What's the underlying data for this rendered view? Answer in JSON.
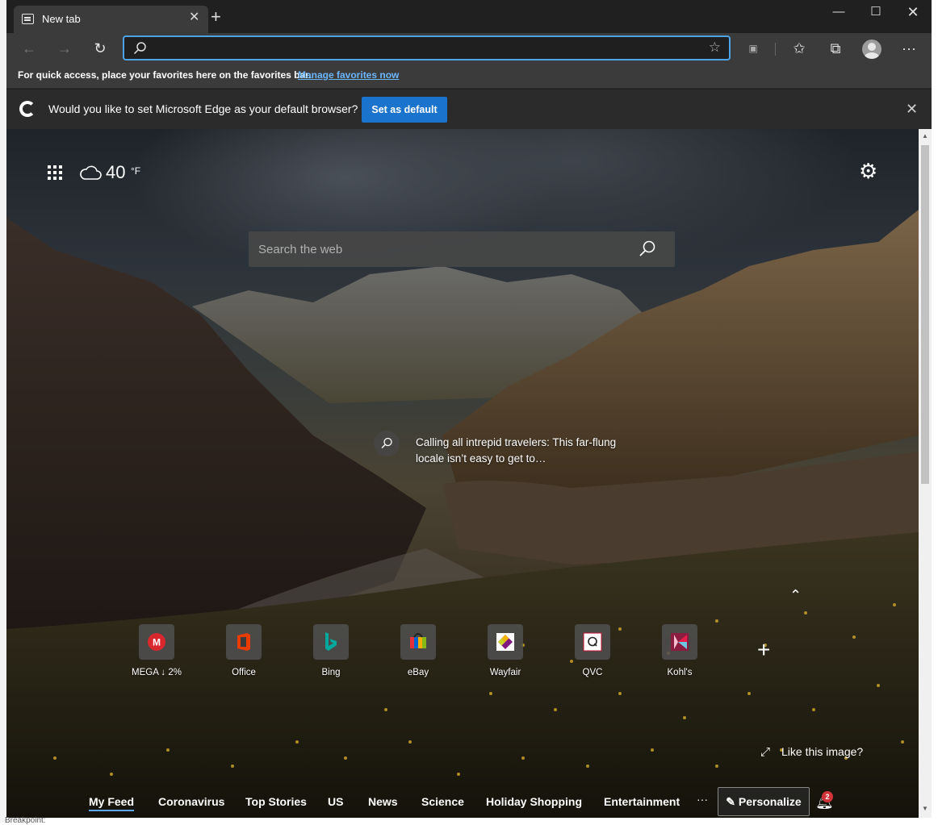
{
  "browser": {
    "tab_title": "New tab",
    "address_value": "",
    "toolbar_icons": [
      "back-icon",
      "forward-icon",
      "refresh-icon",
      "favorite-star-icon",
      "extension-icon",
      "favorites-icon",
      "collections-icon",
      "profile-icon",
      "more-icon"
    ]
  },
  "favorites_bar": {
    "message": "For quick access, place your favorites here on the favorites bar.",
    "link": "Manage favorites now"
  },
  "default_prompt": {
    "question": "Would you like to set Microsoft Edge as your default browser?",
    "button": "Set as default"
  },
  "newtab": {
    "weather_temp": "40",
    "weather_unit": "°F",
    "search_placeholder": "Search the web",
    "caption": "Calling all intrepid travelers: This far-flung locale isn’t easy to get to…",
    "like_image": "Like this image?",
    "quick_links": [
      {
        "label": "MEGA ↓ 2%",
        "color": "#d9272e"
      },
      {
        "label": "Office",
        "color": "#eb3c00"
      },
      {
        "label": "Bing",
        "color": "#008373"
      },
      {
        "label": "eBay",
        "color": "#e53238"
      },
      {
        "label": "Wayfair",
        "color": "#7f187f"
      },
      {
        "label": "QVC",
        "color": "#ffffff"
      },
      {
        "label": "Kohl's",
        "color": "#8b1d41"
      }
    ],
    "feed_tabs": [
      "My Feed",
      "Coronavirus",
      "Top Stories",
      "US",
      "News",
      "Science",
      "Holiday Shopping",
      "Entertainment"
    ],
    "personalize": "Personalize",
    "notification_count": "2"
  },
  "status_text": "Breakpoint:",
  "colors": {
    "accent": "#0f6cbd",
    "link": "#6cb6ff",
    "badge": "#d13438"
  }
}
